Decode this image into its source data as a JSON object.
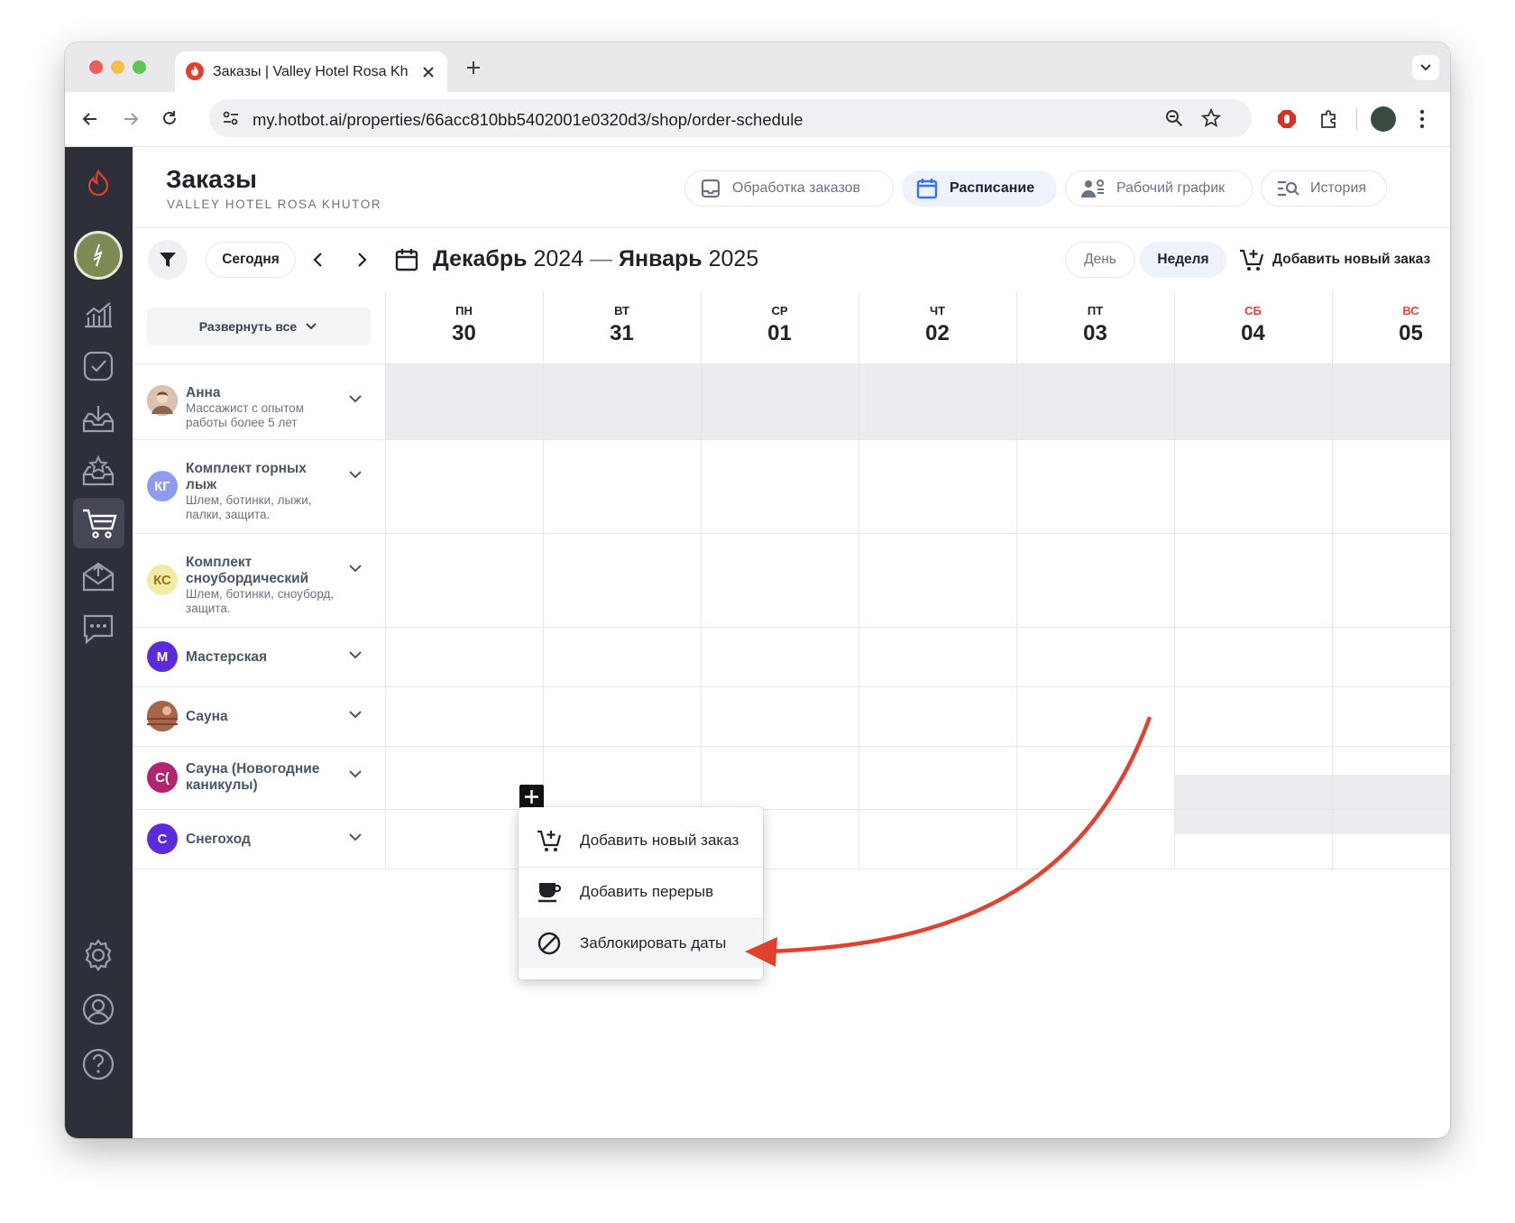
{
  "browser": {
    "tab_title": "Заказы | Valley Hotel Rosa Kh",
    "url": "my.hotbot.ai/properties/66acc810bb5402001e0320d3/shop/order-schedule"
  },
  "header": {
    "title": "Заказы",
    "subtitle": "VALLEY HOTEL ROSA KHUTOR",
    "nav": [
      {
        "label": "Обработка заказов",
        "icon": "tray-icon"
      },
      {
        "label": "Расписание",
        "icon": "calendar-icon",
        "active": true
      },
      {
        "label": "Рабочий график",
        "icon": "staff-icon"
      },
      {
        "label": "История",
        "icon": "history-icon"
      }
    ]
  },
  "controls": {
    "today": "Сегодня",
    "range": {
      "month1": "Декабрь",
      "year1": "2024",
      "dash": "—",
      "month2": "Январь",
      "year2": "2025"
    },
    "view_day": "День",
    "view_week": "Неделя",
    "add_order": "Добавить новый заказ",
    "expand_all": "Развернуть все"
  },
  "days": [
    {
      "dow": "ПН",
      "num": "30",
      "weekend": false
    },
    {
      "dow": "ВТ",
      "num": "31",
      "weekend": false
    },
    {
      "dow": "СР",
      "num": "01",
      "weekend": false
    },
    {
      "dow": "ЧТ",
      "num": "02",
      "weekend": false
    },
    {
      "dow": "ПТ",
      "num": "03",
      "weekend": false
    },
    {
      "dow": "СБ",
      "num": "04",
      "weekend": true
    },
    {
      "dow": "ВС",
      "num": "05",
      "weekend": true
    }
  ],
  "resources": [
    {
      "name": "Анна",
      "desc": "Массажист с опытом работы более 5 лет",
      "initials": "",
      "color": "#b08a70"
    },
    {
      "name": "Комплект горных лыж",
      "desc": "Шлем, ботинки, лыжи, палки, защита.",
      "initials": "КГ",
      "color": "#8f9bef"
    },
    {
      "name": "Комплект сноубордический",
      "desc": "Шлем, ботинки, сноуборд, защита.",
      "initials": "КС",
      "color": "#f3eba3"
    },
    {
      "name": "Мастерская",
      "desc": "",
      "initials": "М",
      "color": "#5b2bdc"
    },
    {
      "name": "Сауна",
      "desc": "",
      "initials": "",
      "color": "#a7664a"
    },
    {
      "name": "Сауна (Новогодние каникулы)",
      "desc": "",
      "initials": "С(",
      "color": "#b3236f"
    },
    {
      "name": "Снегоход",
      "desc": "",
      "initials": "С",
      "color": "#5b2bdc"
    }
  ],
  "context_menu": [
    {
      "label": "Добавить новый заказ",
      "icon": "cart-plus-icon"
    },
    {
      "label": "Добавить перерыв",
      "icon": "coffee-cup-icon"
    },
    {
      "label": "Заблокировать даты",
      "icon": "block-icon"
    }
  ],
  "colors": {
    "accent": "#e3412f",
    "sidebar_bg": "#2e3039",
    "blocked_cell": "#eaecef",
    "weekend_label": "#e0443a"
  }
}
